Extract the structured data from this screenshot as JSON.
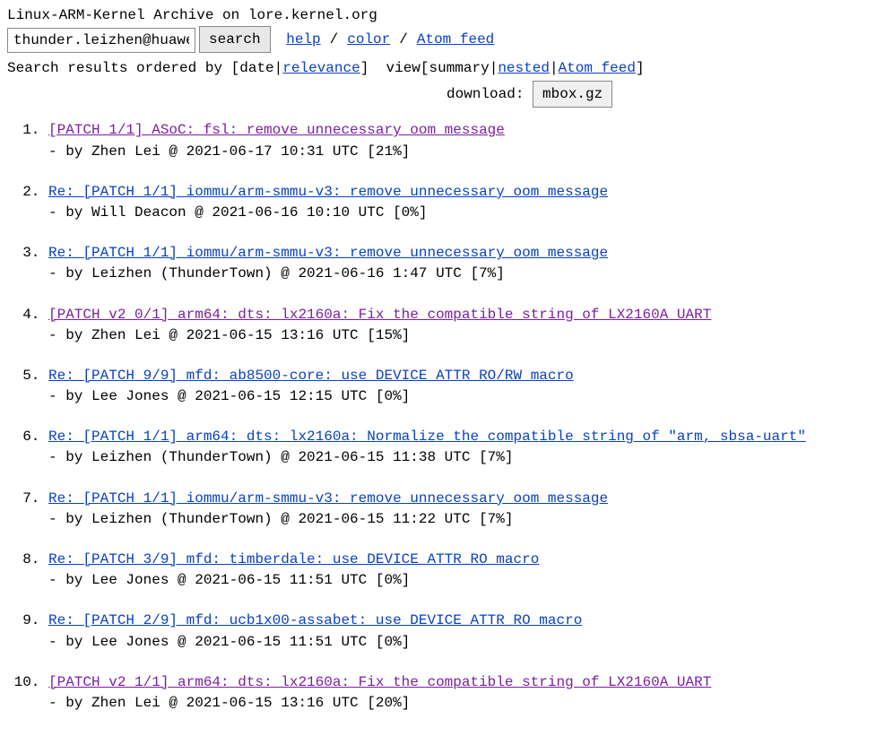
{
  "header": {
    "title": "Linux-ARM-Kernel Archive on lore.kernel.org",
    "search_value": "thunder.leizhen@huawe",
    "search_button": "search",
    "help": "help",
    "color": "color",
    "atom_feed": "Atom feed"
  },
  "view": {
    "prefix": "Search results ordered by [",
    "date": "date",
    "relevance": "relevance",
    "mid": "]  view[",
    "summary": "summary",
    "nested": "nested",
    "atom_feed": "Atom feed",
    "suffix": "]"
  },
  "download": {
    "label": "download: ",
    "button": "mbox.gz"
  },
  "results": [
    {
      "title": "[PATCH 1/1] ASoC: fsl: remove unnecessary oom message",
      "color": "purple",
      "meta": "- by Zhen Lei @ 2021-06-17 10:31 UTC [21%]"
    },
    {
      "title": "Re: [PATCH 1/1] iommu/arm-smmu-v3: remove unnecessary oom message",
      "color": "blue",
      "meta": "- by Will Deacon @ 2021-06-16 10:10 UTC [0%]"
    },
    {
      "title": "Re: [PATCH 1/1] iommu/arm-smmu-v3: remove unnecessary oom message",
      "color": "blue",
      "meta": "- by Leizhen (ThunderTown) @ 2021-06-16  1:47 UTC [7%]"
    },
    {
      "title": "[PATCH v2 0/1] arm64: dts: lx2160a: Fix the compatible string of LX2160A UART",
      "color": "purple",
      "meta": "- by Zhen Lei @ 2021-06-15 13:16 UTC [15%]"
    },
    {
      "title": "Re: [PATCH 9/9] mfd: ab8500-core: use DEVICE_ATTR_RO/RW macro",
      "color": "blue",
      "meta": "- by Lee Jones @ 2021-06-15 12:15 UTC [0%]"
    },
    {
      "title": "Re: [PATCH 1/1] arm64: dts: lx2160a: Normalize the compatible string of \"arm, sbsa-uart\"",
      "color": "blue",
      "meta": "- by Leizhen (ThunderTown) @ 2021-06-15 11:38 UTC [7%]"
    },
    {
      "title": "Re: [PATCH 1/1] iommu/arm-smmu-v3: remove unnecessary oom message",
      "color": "blue",
      "meta": "- by Leizhen (ThunderTown) @ 2021-06-15 11:22 UTC [7%]"
    },
    {
      "title": "Re: [PATCH 3/9] mfd: timberdale: use DEVICE_ATTR_RO macro",
      "color": "blue",
      "meta": "- by Lee Jones @ 2021-06-15 11:51 UTC [0%]"
    },
    {
      "title": "Re: [PATCH 2/9] mfd: ucb1x00-assabet: use DEVICE_ATTR_RO macro",
      "color": "blue",
      "meta": "- by Lee Jones @ 2021-06-15 11:51 UTC [0%]"
    },
    {
      "title": "[PATCH v2 1/1] arm64: dts: lx2160a: Fix the compatible string of LX2160A UART",
      "color": "purple",
      "meta": "- by Zhen Lei @ 2021-06-15 13:16 UTC [20%]"
    }
  ]
}
